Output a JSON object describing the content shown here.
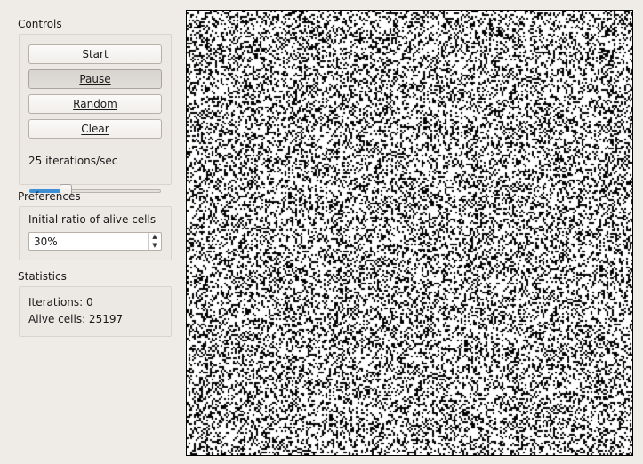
{
  "controls": {
    "title": "Controls",
    "start_label": "Start",
    "pause_label": "Pause",
    "random_label": "Random",
    "clear_label": "Clear",
    "speed_text": "25 iterations/sec",
    "speed_fraction": 0.25
  },
  "preferences": {
    "title": "Preferences",
    "ratio_label": "Initial ratio of alive cells",
    "ratio_value": "30%"
  },
  "statistics": {
    "title": "Statistics",
    "iterations_text": "Iterations: 0",
    "alive_text": "Alive cells: 25197"
  },
  "board": {
    "alive_ratio": 0.3,
    "alive_color": "#000000",
    "dead_color": "#ffffff"
  }
}
